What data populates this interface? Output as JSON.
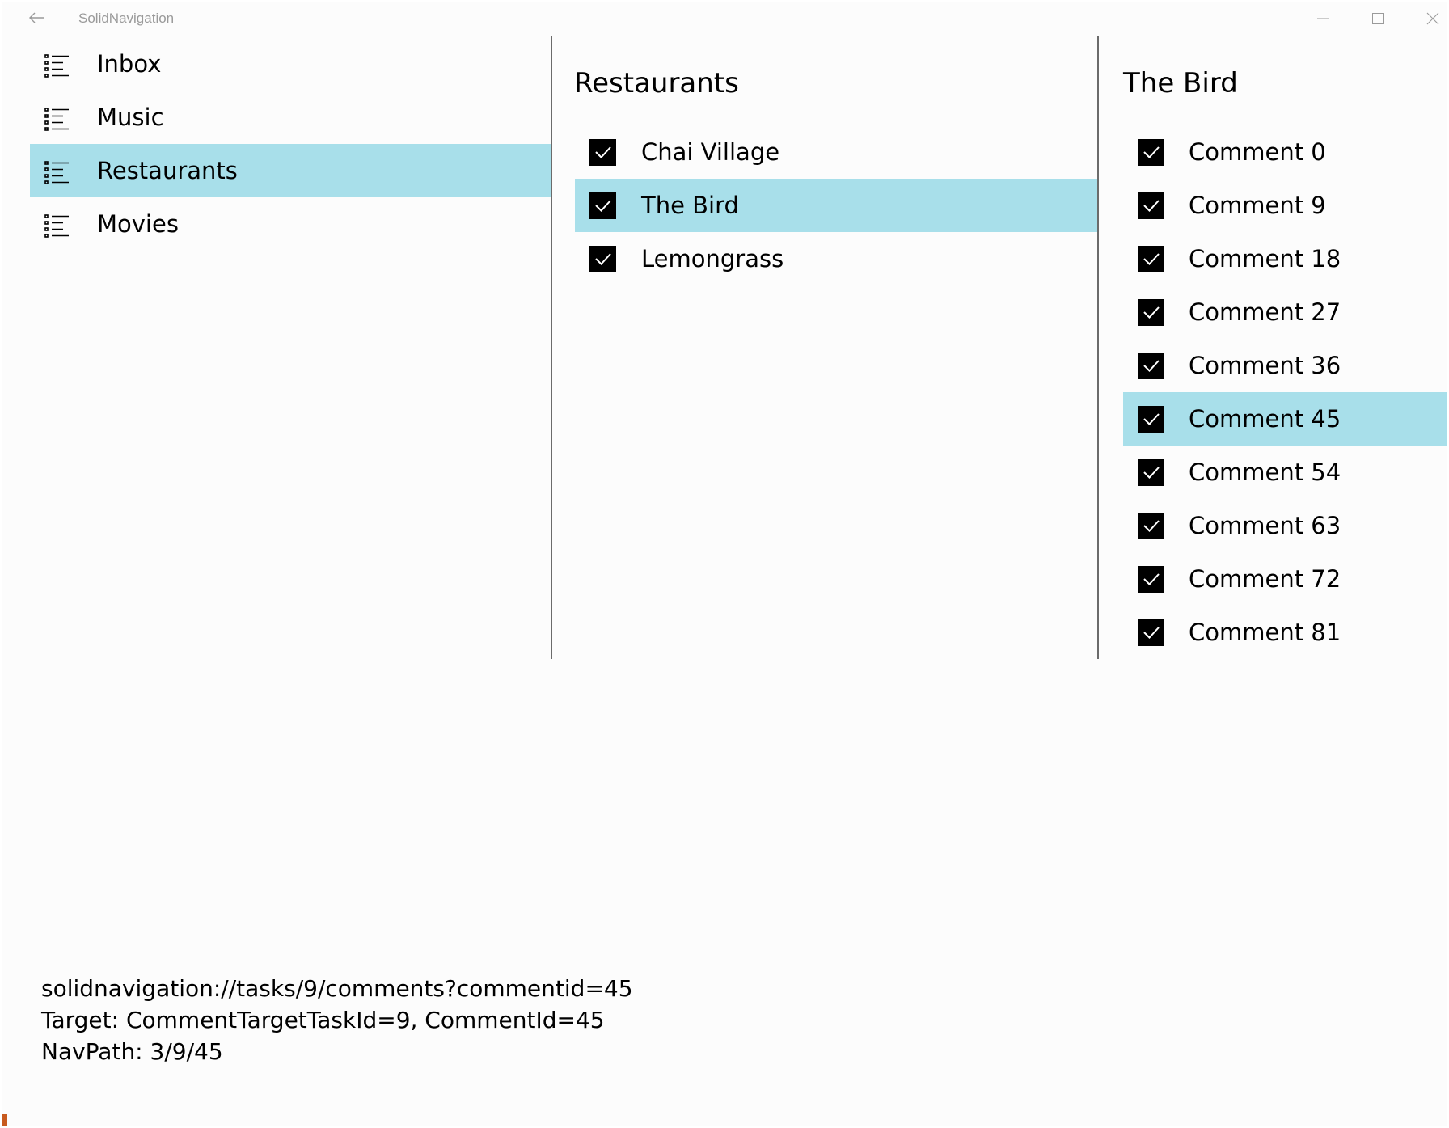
{
  "window": {
    "title": "SolidNavigation"
  },
  "nav": {
    "items": [
      {
        "label": "Inbox",
        "icon": "bulleted-list-icon",
        "selected": false
      },
      {
        "label": "Music",
        "icon": "bulleted-list-icon",
        "selected": false
      },
      {
        "label": "Restaurants",
        "icon": "bulleted-list-icon",
        "selected": true
      },
      {
        "label": "Movies",
        "icon": "bulleted-list-icon",
        "selected": false
      }
    ]
  },
  "tasks": {
    "heading": "Restaurants",
    "items": [
      {
        "label": "Chai Village",
        "checked": true,
        "selected": false
      },
      {
        "label": "The Bird",
        "checked": true,
        "selected": true
      },
      {
        "label": "Lemongrass",
        "checked": true,
        "selected": false
      }
    ]
  },
  "comments": {
    "heading": "The Bird",
    "items": [
      {
        "label": "Comment 0",
        "checked": true,
        "selected": false
      },
      {
        "label": "Comment 9",
        "checked": true,
        "selected": false
      },
      {
        "label": "Comment 18",
        "checked": true,
        "selected": false
      },
      {
        "label": "Comment 27",
        "checked": true,
        "selected": false
      },
      {
        "label": "Comment 36",
        "checked": true,
        "selected": false
      },
      {
        "label": "Comment 45",
        "checked": true,
        "selected": true
      },
      {
        "label": "Comment 54",
        "checked": true,
        "selected": false
      },
      {
        "label": "Comment 63",
        "checked": true,
        "selected": false
      },
      {
        "label": "Comment 72",
        "checked": true,
        "selected": false
      },
      {
        "label": "Comment 81",
        "checked": true,
        "selected": false
      }
    ]
  },
  "status": {
    "uri": "solidnavigation://tasks/9/comments?commentid=45",
    "target": "Target: CommentTargetTaskId=9, CommentId=45",
    "navpath": "NavPath: 3/9/45"
  },
  "colors": {
    "selection": "#a8dfea",
    "divider": "#6b6b6b",
    "background": "#fcfcfc"
  }
}
